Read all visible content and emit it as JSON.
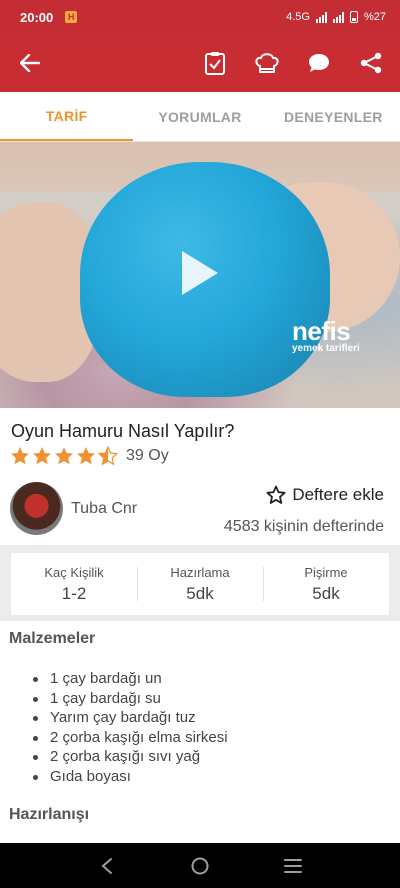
{
  "status_bar": {
    "time": "20:00",
    "network": "4.5G",
    "battery": "%27"
  },
  "tabs": [
    {
      "label": "TARİF"
    },
    {
      "label": "YORUMLAR"
    },
    {
      "label": "DENEYENLER"
    }
  ],
  "video": {
    "brand_logo": "nefis",
    "brand_sub": "yemek tarifleri"
  },
  "recipe": {
    "title": "Oyun Hamuru Nasıl Yapılır?",
    "rating": 4.5,
    "rating_count": "39 Oy",
    "author": "Tuba Cnr",
    "save_label": "Deftere ekle",
    "saved_count": "4583 kişinin defterinde"
  },
  "stats": [
    {
      "label": "Kaç Kişilik",
      "value": "1-2"
    },
    {
      "label": "Hazırlama",
      "value": "5dk"
    },
    {
      "label": "Pişirme",
      "value": "5dk"
    }
  ],
  "ingredients_title": "Malzemeler",
  "ingredients": [
    "1 çay bardağı un",
    "1 çay bardağı su",
    "Yarım çay bardağı tuz",
    "2 çorba kaşığı elma sirkesi",
    "2 çorba kaşığı sıvı yağ",
    "Gıda boyası"
  ],
  "preparation_title": "Hazırlanışı",
  "colors": {
    "primary": "#c92d34",
    "accent": "#f0922f"
  }
}
